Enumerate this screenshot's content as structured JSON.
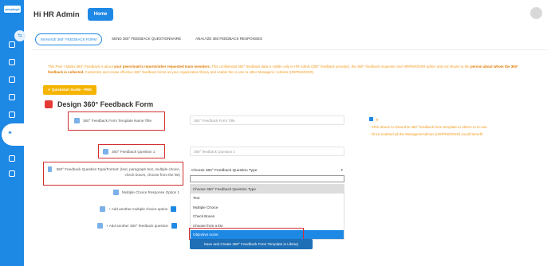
{
  "sidebar": {
    "logo": "peoplegrt"
  },
  "header": {
    "greeting": "Hi HR Admin",
    "home_label": "Home"
  },
  "tabs": [
    {
      "label": "MANAGE 360° FEEDBACK FORM"
    },
    {
      "label": "SEND 360° FEEDBACK QUESTIONNAIRE"
    },
    {
      "label": "ANALYZE 360 FEEDBACK RESPONSES"
    }
  ],
  "info": {
    "text_a": "This Peer / Matrix 360° Feedback is about ",
    "text_bold_a": "your peers/matrix reports/other requested team members.",
    "text_b": " This confidential 360° feedback data is visible only to HR Admin (360° feedback provider), the 360° feedback requester and HR/PMS/OKR admin and not shown to the ",
    "text_bold_b": "person about whom the 360° feedback is collected.",
    "text_c": " Customize and create effective 360° feedback forms as your organization library and enable the re-use to other Managers / Admins (HR/PMS/OKR)."
  },
  "quickstart_label": "Quickstart Guide - PMS",
  "section_title": "Design 360° Feedback Form",
  "form": {
    "template_name_label": "360° Feedback Form Template Name Title",
    "template_name_placeholder": "360° Feedback Form Title",
    "question_label": "360° Feedback Question 1",
    "question_placeholder": "360° feedback Question 1",
    "type_label": "360° Feedback Question Type/Format: (text, paragraph text, multiple choice, check boxes, choose from the list)",
    "type_selected": "Choose 360° Feedback Question Type",
    "mc_option_label": "Multiple Choice Response Option 1",
    "add_mc_label": "+ Add another multiple choice option",
    "add_question_label": "+ Add another 360° feedback question"
  },
  "notes": [
    "- Click above to show this 360° feedback form template to others to re-use",
    "- Once enabled all the Managers/Admins (HR/PMS/OKR) would benefit"
  ],
  "dropdown_options": [
    "Choose 360° Feedback Question Type",
    "Text",
    "Multiple Choice",
    "Check Boxes",
    "Choose from a list",
    "Objective score"
  ],
  "save_label": "Save and Create 360° Feedback Form Template in Library",
  "colors": {
    "accent": "#1e88e5",
    "warning": "#f29a1c",
    "highlight": "#d32f2f"
  }
}
